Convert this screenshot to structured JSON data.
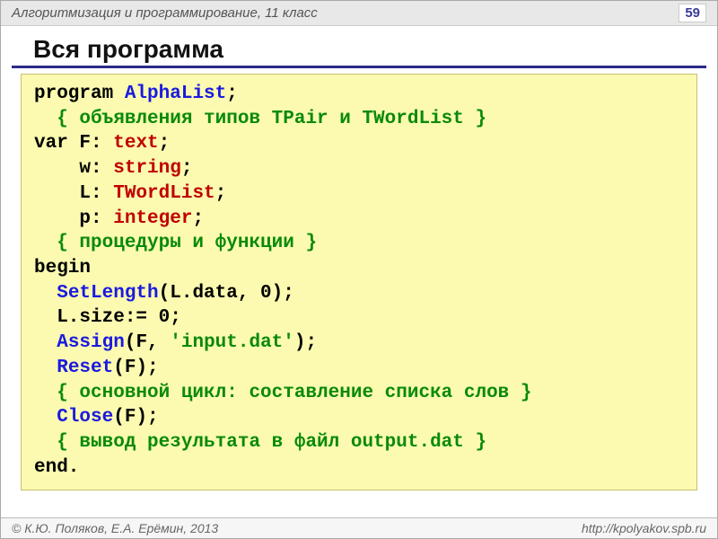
{
  "header": {
    "subject": "Алгоритмизация и программирование, 11 класс",
    "page_number": "59"
  },
  "title": "Вся программа",
  "code": {
    "l1_program": "program ",
    "l1_name": "AlphaList",
    "l1_semi": ";",
    "l2_comment": "  { объявления типов TPair и TWordList }",
    "l3_var": "var ",
    "l3_F": "F: ",
    "l3_type": "text",
    "l3_semi": ";",
    "l4_pad": "    ",
    "l4_w": "w: ",
    "l4_type": "string",
    "l4_semi": ";",
    "l5_pad": "    ",
    "l5_L": "L: ",
    "l5_type": "TWordList",
    "l5_semi": ";",
    "l6_pad": "    ",
    "l6_p": "p: ",
    "l6_type": "integer",
    "l6_semi": ";",
    "l7_comment": "  { процедуры и функции }",
    "l8_begin": "begin",
    "l9_pad": "  ",
    "l9_fn": "SetLength",
    "l9_args": "(L.data, 0);",
    "l10": "  L.size:= 0;",
    "l11_pad": "  ",
    "l11_fn": "Assign",
    "l11_open": "(F, ",
    "l11_str": "'input.dat'",
    "l11_close": ");",
    "l12_pad": "  ",
    "l12_fn": "Reset",
    "l12_args": "(F);",
    "l13_comment": "  { основной цикл: составление списка слов }",
    "l14_pad": "  ",
    "l14_fn": "Close",
    "l14_args": "(F);",
    "l15_comment": "  { вывод результата в файл output.dat }",
    "l16_end": "end."
  },
  "footer": {
    "authors": "© К.Ю. Поляков, Е.А. Ерёмин, 2013",
    "url": "http://kpolyakov.spb.ru"
  }
}
